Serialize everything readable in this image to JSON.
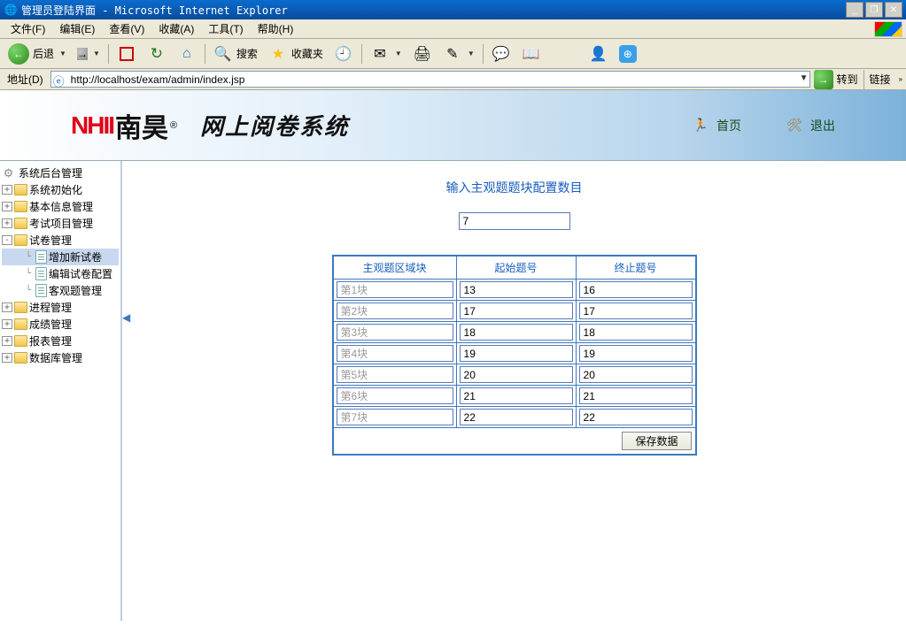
{
  "window": {
    "title": "管理员登陆界面 - Microsoft Internet Explorer"
  },
  "menu": [
    "文件(F)",
    "编辑(E)",
    "查看(V)",
    "收藏(A)",
    "工具(T)",
    "帮助(H)"
  ],
  "toolbar": {
    "back": "后退",
    "search": "搜索",
    "favorites": "收藏夹"
  },
  "address": {
    "label": "地址(D)",
    "url": "http://localhost/exam/admin/index.jsp",
    "go": "转到",
    "links": "链接"
  },
  "banner": {
    "brand_en": "NHII",
    "brand_cn": "南昊",
    "app_title": "网上阅卷系统",
    "home": "首页",
    "exit": "退出"
  },
  "sidebar": {
    "root": "系统后台管理",
    "items": [
      {
        "label": "系统初始化",
        "expand": "+"
      },
      {
        "label": "基本信息管理",
        "expand": "+"
      },
      {
        "label": "考试项目管理",
        "expand": "+"
      },
      {
        "label": "试卷管理",
        "expand": "-",
        "children": [
          {
            "label": "增加新试卷",
            "selected": true
          },
          {
            "label": "编辑试卷配置"
          },
          {
            "label": "客观题管理"
          }
        ]
      },
      {
        "label": "进程管理",
        "expand": "+"
      },
      {
        "label": "成绩管理",
        "expand": "+"
      },
      {
        "label": "报表管理",
        "expand": "+"
      },
      {
        "label": "数据库管理",
        "expand": "+"
      }
    ]
  },
  "form": {
    "heading": "输入主观题题块配置数目",
    "count_value": "7",
    "headers": [
      "主观题区域块",
      "起始题号",
      "终止题号"
    ],
    "rows": [
      {
        "area": "第1块",
        "start": "13",
        "end": "16"
      },
      {
        "area": "第2块",
        "start": "17",
        "end": "17"
      },
      {
        "area": "第3块",
        "start": "18",
        "end": "18"
      },
      {
        "area": "第4块",
        "start": "19",
        "end": "19"
      },
      {
        "area": "第5块",
        "start": "20",
        "end": "20"
      },
      {
        "area": "第6块",
        "start": "21",
        "end": "21"
      },
      {
        "area": "第7块",
        "start": "22",
        "end": "22"
      }
    ],
    "save_label": "保存数据"
  }
}
